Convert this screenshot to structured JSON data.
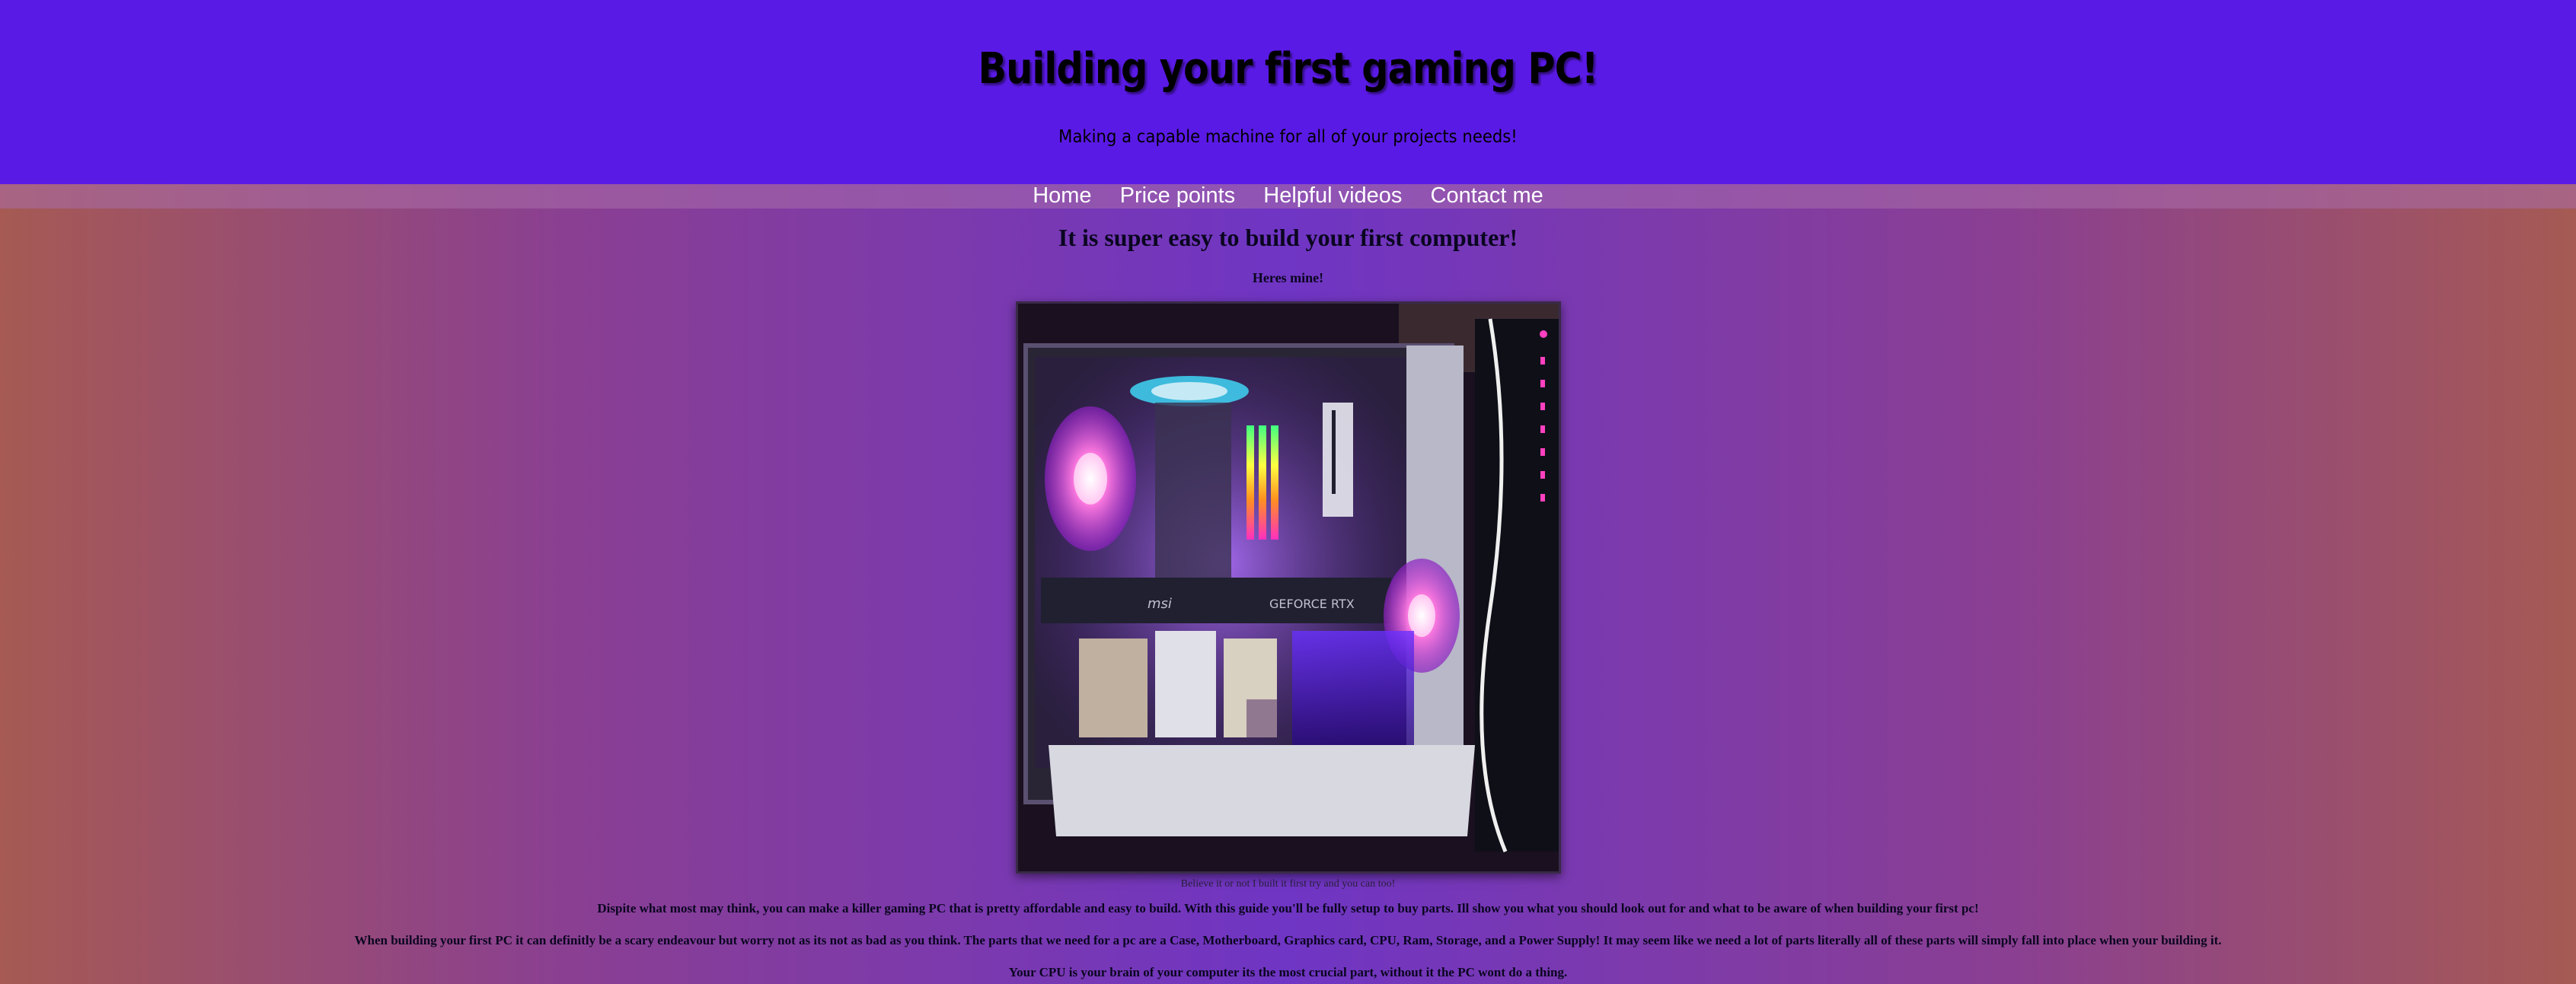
{
  "header": {
    "title": "Building your first gaming PC!",
    "subtitle": "Making a capable machine for all of your projects needs!"
  },
  "nav": {
    "items": [
      {
        "label": "Home"
      },
      {
        "label": "Price points"
      },
      {
        "label": "Helpful videos"
      },
      {
        "label": "Contact me"
      }
    ]
  },
  "main": {
    "headline": "It is super easy to build your first computer!",
    "subhead": "Heres mine!",
    "photo": {
      "case_text_1": "msi",
      "case_text_2": "GEFORCE RTX"
    },
    "caption": "Believe it or not I built it first try and you can too!",
    "paragraphs": [
      "Dispite what most may think, you can make a killer gaming PC that is pretty affordable and easy to build. With this guide you'll be fully setup to buy parts. Ill show you what you should look out for and what to be aware of when building your first pc!",
      "When building your first PC it can definitly be a scary endeavour but worry not as its not as bad as you think. The parts that we need for a pc are a Case, Motherboard, Graphics card, CPU, Ram, Storage, and a Power Supply! It may seem like we need a lot of parts literally all of these parts will simply fall into place when your building it.",
      "Your CPU is your brain of your computer its the most crucial part, without it the PC wont do a thing."
    ]
  },
  "colors": {
    "header_bg": "#5a1ae6",
    "nav_text": "#ffffff",
    "page_gradient_edge": "#a65a53",
    "page_gradient_center": "#6f35c4"
  }
}
